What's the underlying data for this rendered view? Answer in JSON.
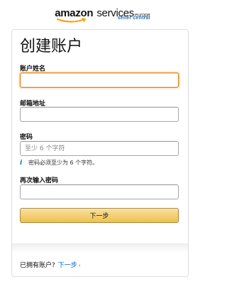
{
  "logo": {
    "brand": "amazon",
    "services": "services",
    "region": "europe",
    "subtitle": "seller central"
  },
  "form": {
    "title": "创建账户",
    "name_label": "账户姓名",
    "name_value": "",
    "email_label": "邮箱地址",
    "email_value": "",
    "password_label": "密码",
    "password_placeholder": "至少 6 个字符",
    "password_hint": "密码必须至少为 6 个字符。",
    "password_hint_icon": "info-icon",
    "confirm_label": "再次输入密码",
    "confirm_value": "",
    "submit_label": "下一步"
  },
  "footer": {
    "have_account": "已拥有账户?",
    "signin_link": "下一步",
    "signin_caret": "›"
  },
  "colors": {
    "button_top": "#f7dfa5",
    "button_bottom": "#f0c14b",
    "focus": "#e77600",
    "link": "#0066c0",
    "logo_sub": "#2a6fb5"
  }
}
